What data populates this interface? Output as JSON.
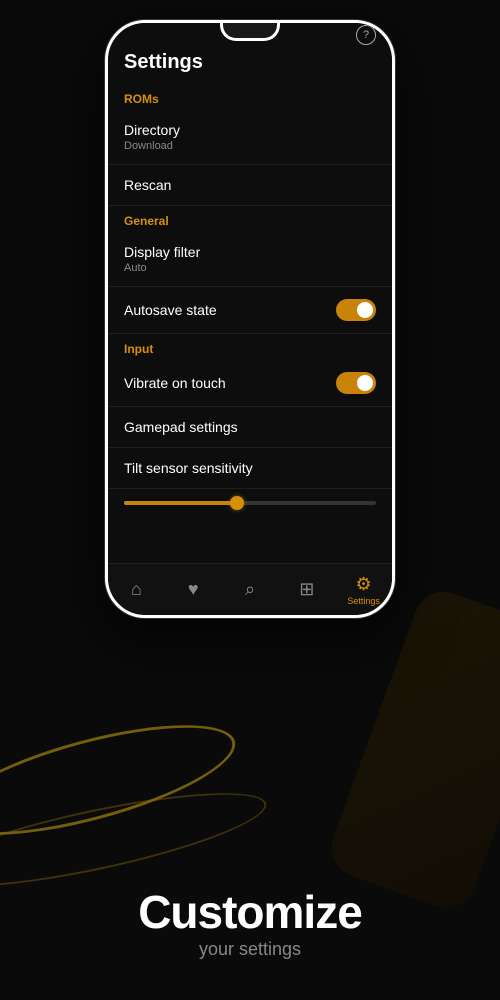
{
  "app": {
    "background_color": "#0a0a0a"
  },
  "phone": {
    "help_icon": "?",
    "screen": {
      "title": "Settings",
      "sections": [
        {
          "label": "ROMs",
          "items": [
            {
              "id": "directory",
              "main": "Directory",
              "sub": "Download",
              "type": "nav"
            },
            {
              "id": "rescan",
              "main": "Rescan",
              "sub": null,
              "type": "nav"
            }
          ]
        },
        {
          "label": "General",
          "items": [
            {
              "id": "display-filter",
              "main": "Display filter",
              "sub": "Auto",
              "type": "nav"
            },
            {
              "id": "autosave-state",
              "main": "Autosave state",
              "sub": null,
              "type": "toggle",
              "value": true
            }
          ]
        },
        {
          "label": "Input",
          "items": [
            {
              "id": "vibrate-on-touch",
              "main": "Vibrate on touch",
              "sub": null,
              "type": "toggle",
              "value": true
            },
            {
              "id": "gamepad-settings",
              "main": "Gamepad settings",
              "sub": null,
              "type": "nav"
            },
            {
              "id": "tilt-sensor",
              "main": "Tilt sensor sensitivity",
              "sub": null,
              "type": "slider",
              "value": 45
            }
          ]
        }
      ],
      "bottom_nav": [
        {
          "id": "home",
          "icon": "⌂",
          "label": "",
          "active": false
        },
        {
          "id": "favorites",
          "icon": "♥",
          "label": "",
          "active": false
        },
        {
          "id": "search",
          "icon": "⌕",
          "label": "",
          "active": false
        },
        {
          "id": "gamepad",
          "icon": "⊞",
          "label": "",
          "active": false
        },
        {
          "id": "settings",
          "icon": "⚙",
          "label": "Settings",
          "active": true
        }
      ]
    }
  },
  "bottom": {
    "headline": "Customize",
    "subline": "your settings"
  }
}
